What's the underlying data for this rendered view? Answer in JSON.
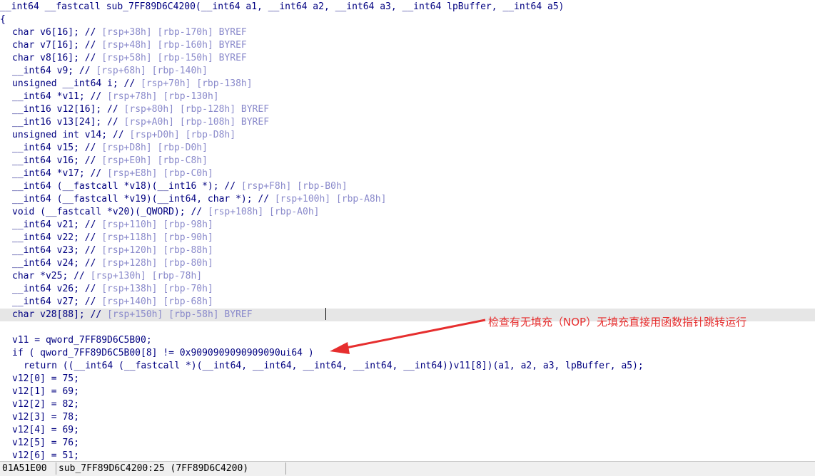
{
  "code": {
    "lines": [
      [
        {
          "t": "__int64 __fastcall sub_7FF89D6C4200(__int64 a1, __int64 a2, __int64 a3, __int64 lpBuffer, __int64 a5)"
        }
      ],
      [
        {
          "t": "{"
        }
      ],
      [
        {
          "t": "char v6[16]; // "
        },
        {
          "c": "[rsp+38h] [rbp-170h] BYREF"
        }
      ],
      [
        {
          "t": "char v7[16]; // "
        },
        {
          "c": "[rsp+48h] [rbp-160h] BYREF"
        }
      ],
      [
        {
          "t": "char v8[16]; // "
        },
        {
          "c": "[rsp+58h] [rbp-150h] BYREF"
        }
      ],
      [
        {
          "t": "__int64 v9; // "
        },
        {
          "c": "[rsp+68h] [rbp-140h]"
        }
      ],
      [
        {
          "t": "unsigned __int64 i; // "
        },
        {
          "c": "[rsp+70h] [rbp-138h]"
        }
      ],
      [
        {
          "t": "__int64 *v11; // "
        },
        {
          "c": "[rsp+78h] [rbp-130h]"
        }
      ],
      [
        {
          "t": "__int16 v12[16]; // "
        },
        {
          "c": "[rsp+80h] [rbp-128h] BYREF"
        }
      ],
      [
        {
          "t": "__int16 v13[24]; // "
        },
        {
          "c": "[rsp+A0h] [rbp-108h] BYREF"
        }
      ],
      [
        {
          "t": "unsigned int v14; // "
        },
        {
          "c": "[rsp+D0h] [rbp-D8h]"
        }
      ],
      [
        {
          "t": "__int64 v15; // "
        },
        {
          "c": "[rsp+D8h] [rbp-D0h]"
        }
      ],
      [
        {
          "t": "__int64 v16; // "
        },
        {
          "c": "[rsp+E0h] [rbp-C8h]"
        }
      ],
      [
        {
          "t": "__int64 *v17; // "
        },
        {
          "c": "[rsp+E8h] [rbp-C0h]"
        }
      ],
      [
        {
          "t": "__int64 (__fastcall *v18)(__int16 *); // "
        },
        {
          "c": "[rsp+F8h] [rbp-B0h]"
        }
      ],
      [
        {
          "t": "__int64 (__fastcall *v19)(__int64, char *); // "
        },
        {
          "c": "[rsp+100h] [rbp-A8h]"
        }
      ],
      [
        {
          "t": "void (__fastcall *v20)(_QWORD); // "
        },
        {
          "c": "[rsp+108h] [rbp-A0h]"
        }
      ],
      [
        {
          "t": "__int64 v21; // "
        },
        {
          "c": "[rsp+110h] [rbp-98h]"
        }
      ],
      [
        {
          "t": "__int64 v22; // "
        },
        {
          "c": "[rsp+118h] [rbp-90h]"
        }
      ],
      [
        {
          "t": "__int64 v23; // "
        },
        {
          "c": "[rsp+120h] [rbp-88h]"
        }
      ],
      [
        {
          "t": "__int64 v24; // "
        },
        {
          "c": "[rsp+128h] [rbp-80h]"
        }
      ],
      [
        {
          "t": "char *v25; // "
        },
        {
          "c": "[rsp+130h] [rbp-78h]"
        }
      ],
      [
        {
          "t": "__int64 v26; // "
        },
        {
          "c": "[rsp+138h] [rbp-70h]"
        }
      ],
      [
        {
          "t": "__int64 v27; // "
        },
        {
          "c": "[rsp+140h] [rbp-68h]"
        }
      ],
      [
        {
          "t": "char v28[88]; // "
        },
        {
          "c": "[rsp+150h] [rbp-58h] BYREF"
        }
      ],
      [],
      [
        {
          "t": "v11 = qword_7FF89D6C5B00;"
        }
      ],
      [
        {
          "t": "if ( qword_7FF89D6C5B00[8] != 0x9090909090909090ui64 )"
        }
      ],
      [
        {
          "t": "return ((__int64 (__fastcall *)(__int64, __int64, __int64, __int64, __int64))v11[8])(a1, a2, a3, lpBuffer, a5);"
        }
      ],
      [
        {
          "t": "v12[0] = 75;"
        }
      ],
      [
        {
          "t": "v12[1] = 69;"
        }
      ],
      [
        {
          "t": "v12[2] = 82;"
        }
      ],
      [
        {
          "t": "v12[3] = 78;"
        }
      ],
      [
        {
          "t": "v12[4] = 69;"
        }
      ],
      [
        {
          "t": "v12[5] = 76;"
        }
      ],
      [
        {
          "t": "v12[6] = 51;"
        }
      ]
    ],
    "indent": [
      0,
      0,
      1,
      1,
      1,
      1,
      1,
      1,
      1,
      1,
      1,
      1,
      1,
      1,
      1,
      1,
      1,
      1,
      1,
      1,
      1,
      1,
      1,
      1,
      1,
      0,
      1,
      1,
      2,
      1,
      1,
      1,
      1,
      1,
      1,
      1
    ],
    "highlighted_line": 24
  },
  "annotation": {
    "text": "检查有无填充（NOP）无填充直接用函数指针跳转运行",
    "color": "#e62e2e"
  },
  "status_bar": {
    "address": "01A51E00",
    "location": "sub_7FF89D6C4200:25 (7FF89D6C4200)"
  }
}
